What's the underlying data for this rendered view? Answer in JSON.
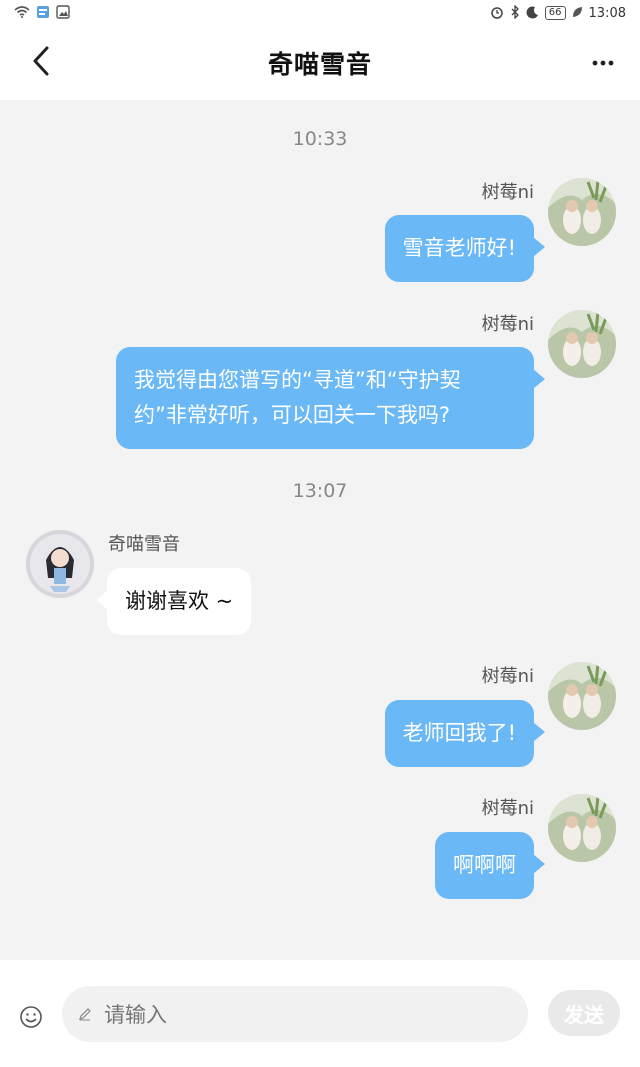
{
  "status_bar": {
    "time": "13:08",
    "battery": "66",
    "left_icons": [
      "wifi-icon",
      "app-icon",
      "image-icon"
    ],
    "right_icons": [
      "alarm-icon",
      "bluetooth-icon",
      "moon-icon",
      "battery-icon",
      "leaf-icon"
    ]
  },
  "header": {
    "title": "奇喵雪音",
    "back_icon": "chevron-left-icon",
    "more_icon": "more-dots-icon"
  },
  "chat": {
    "timestamps": [
      "10:33",
      "13:07"
    ],
    "messages": [
      {
        "sender": "树莓ni",
        "side": "right",
        "text_lines": [
          "雪音老师好!"
        ]
      },
      {
        "sender": "树莓ni",
        "side": "right",
        "text_lines": [
          "我觉得由您谱写的“寻道”和“守护契",
          "约”非常好听，可以回关一下我吗?"
        ]
      },
      {
        "sender": "奇喵雪音",
        "side": "left",
        "text_lines": [
          "谢谢喜欢 ~"
        ]
      },
      {
        "sender": "树莓ni",
        "side": "right",
        "text_lines": [
          "老师回我了!"
        ]
      },
      {
        "sender": "树莓ni",
        "side": "right",
        "text_lines": [
          "啊啊啊"
        ]
      }
    ]
  },
  "input_bar": {
    "emoji_icon": "smiley-icon",
    "pencil_icon": "pencil-icon",
    "placeholder": "请输入",
    "send_label": "发送"
  },
  "colors": {
    "accent_bubble": "#6ab8f5",
    "background": "#f3f3f3",
    "send_disabled": "#e9e9e9"
  }
}
